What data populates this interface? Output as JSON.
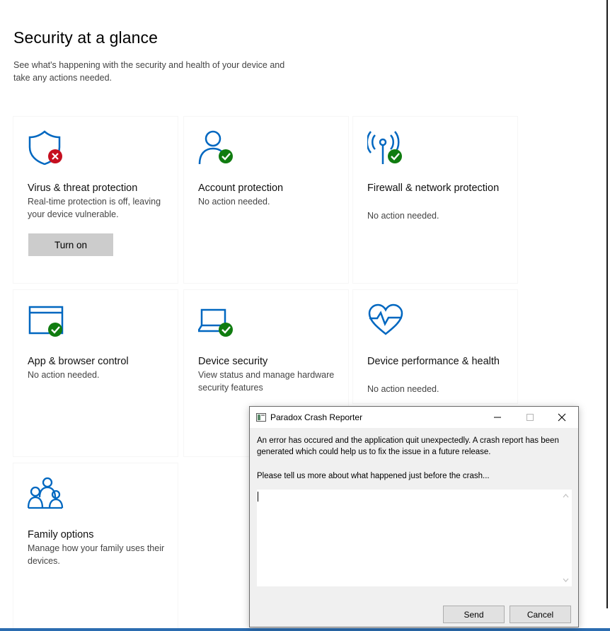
{
  "header": {
    "title": "Security at a glance",
    "subtitle": "See what's happening with the security and health of your device and take any actions needed."
  },
  "cards": [
    {
      "icon": "shield-error-icon",
      "title": "Virus & threat protection",
      "description": "Real-time protection is off, leaving your device vulnerable.",
      "action": "Turn on"
    },
    {
      "icon": "account-check-icon",
      "title": "Account protection",
      "description": "No action needed."
    },
    {
      "icon": "firewall-check-icon",
      "title": "Firewall & network protection",
      "description": "No action needed."
    },
    {
      "icon": "browser-check-icon",
      "title": "App & browser control",
      "description": "No action needed."
    },
    {
      "icon": "laptop-check-icon",
      "title": "Device security",
      "description": "View status and manage hardware security features"
    },
    {
      "icon": "heart-health-icon",
      "title": "Device performance & health",
      "description": "No action needed."
    },
    {
      "icon": "family-icon",
      "title": "Family options",
      "description": "Manage how your family uses their devices."
    }
  ],
  "colors": {
    "accent": "#0067c0",
    "ok": "#107c10",
    "error": "#c50f1f"
  },
  "dialog": {
    "title": "Paradox Crash Reporter",
    "message": "An error has occured and the application quit unexpectedly. A crash report has been generated which could help us to fix the issue in a future release.",
    "prompt": "Please tell us more about what happened just before the crash...",
    "input_value": "",
    "send_label": "Send",
    "cancel_label": "Cancel"
  }
}
